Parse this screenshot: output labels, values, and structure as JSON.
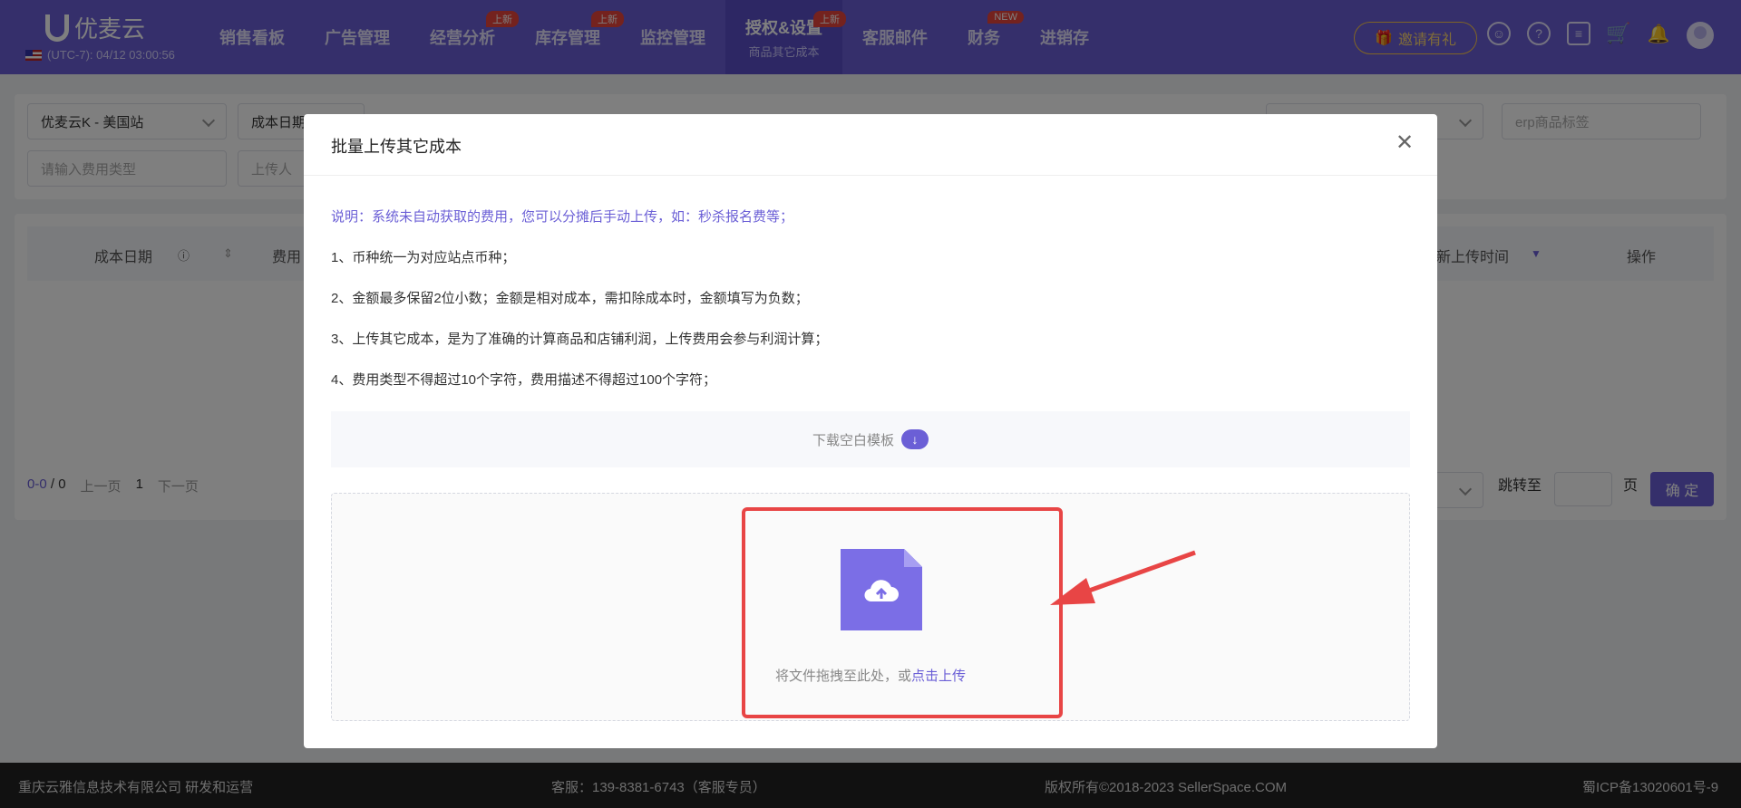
{
  "nav": {
    "brand": "优麦云",
    "timezone": "(UTC-7): 04/12 03:00:56",
    "items": [
      {
        "label": "销售看板",
        "badge": ""
      },
      {
        "label": "广告管理",
        "badge": ""
      },
      {
        "label": "经营分析",
        "badge": "上新"
      },
      {
        "label": "库存管理",
        "badge": "上新"
      },
      {
        "label": "监控管理",
        "badge": ""
      },
      {
        "label": "授权&设置",
        "badge": "上新",
        "sub": "商品其它成本"
      },
      {
        "label": "客服邮件",
        "badge": ""
      },
      {
        "label": "财务",
        "badge": "NEW"
      },
      {
        "label": "进销存",
        "badge": ""
      }
    ],
    "invite": "邀请有礼"
  },
  "filters": {
    "shop": "优麦云K - 美国站",
    "cost_date": "成本日期",
    "erp_tag_placeholder": "erp商品标签",
    "fee_type_placeholder": "请输入费用类型",
    "uploader_placeholder": "上传人"
  },
  "table": {
    "col_cost_date": "成本日期",
    "col_fee": "费用",
    "col_upload_time": "新上传时间",
    "col_action": "操作"
  },
  "pager": {
    "count": "0-0",
    "total": "/ 0",
    "prev": "上一页",
    "page": "1",
    "next": "下一页",
    "jump_label": "跳转至",
    "page_unit": "页",
    "confirm": "确 定"
  },
  "modal": {
    "title": "批量上传其它成本",
    "intro": "说明：系统未自动获取的费用，您可以分摊后手动上传，如：秒杀报名费等；",
    "rules": [
      "1、币种统一为对应站点币种；",
      "2、金额最多保留2位小数；金额是相对成本，需扣除成本时，金额填写为负数；",
      "3、上传其它成本，是为了准确的计算商品和店铺利润，上传费用会参与利润计算；",
      "4、费用类型不得超过10个字符，费用描述不得超过100个字符；"
    ],
    "download_template": "下载空白模板",
    "drop_text": "将文件拖拽至此处，或",
    "drop_link": "点击上传"
  },
  "footer": {
    "company": "重庆云雅信息技术有限公司 研发和运营",
    "service": "客服：139-8381-6743（客服专员）",
    "copyright": "版权所有©2018-2023 SellerSpace.COM",
    "icp": "蜀ICP备13020601号-9"
  }
}
